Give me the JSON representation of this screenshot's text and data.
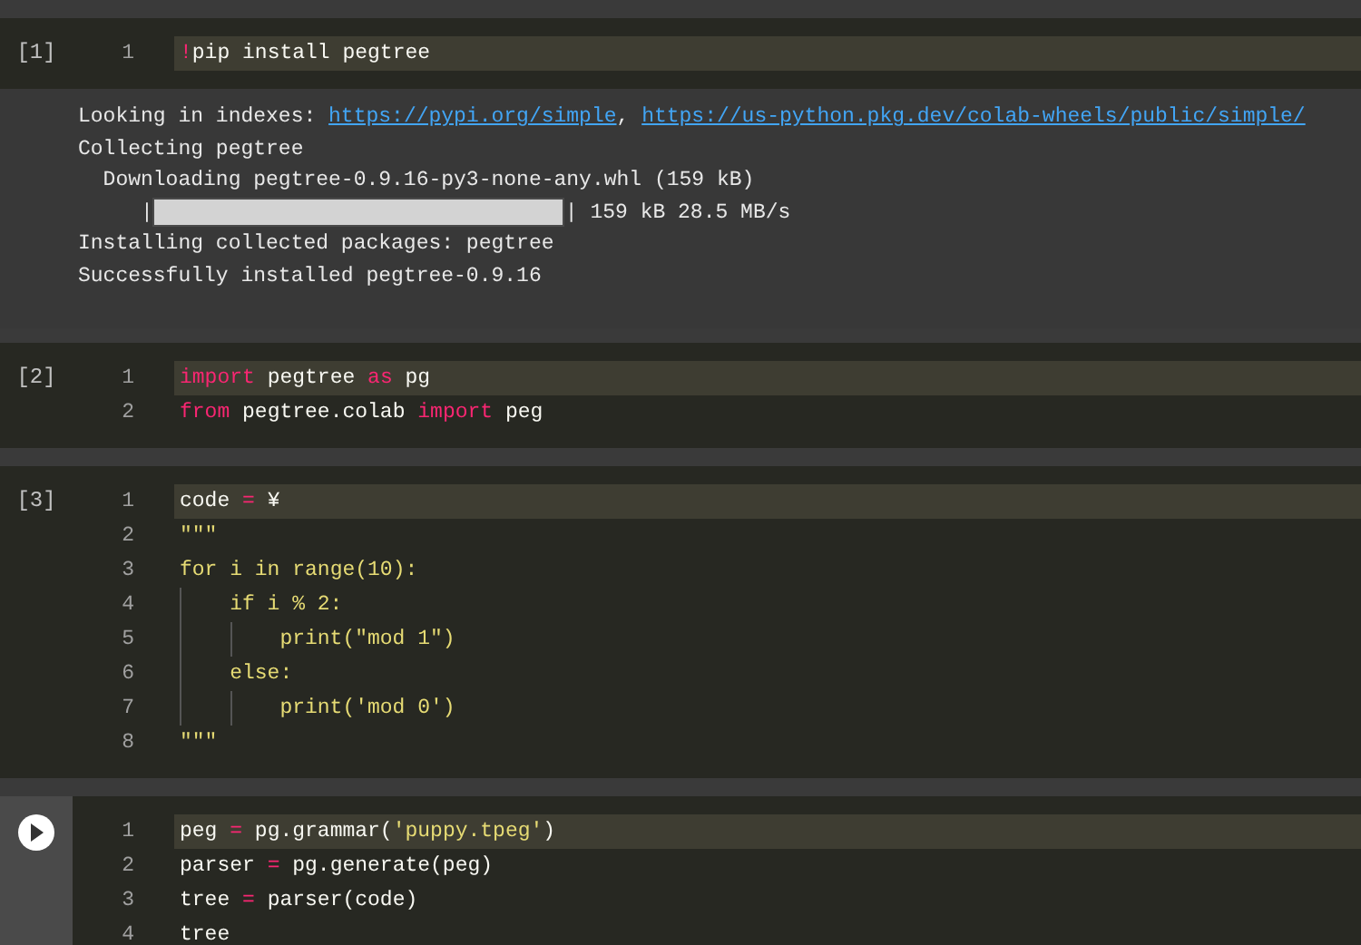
{
  "cells": [
    {
      "prompt": "[1]",
      "run_button": false,
      "lines": [
        {
          "number": "1",
          "current": true,
          "tokens": [
            {
              "kind": "kw",
              "text": "!"
            },
            {
              "kind": "plain",
              "text": "pip install pegtree"
            }
          ]
        }
      ],
      "output": [
        {
          "kind": "links",
          "parts": [
            {
              "kind": "text",
              "text": "Looking in indexes: "
            },
            {
              "kind": "link",
              "text": "https://pypi.org/simple"
            },
            {
              "kind": "text",
              "text": ", "
            },
            {
              "kind": "link",
              "text": "https://us-python.pkg.dev/colab-wheels/public/simple/"
            }
          ]
        },
        {
          "kind": "text",
          "text": "Collecting pegtree"
        },
        {
          "kind": "text",
          "text": "  Downloading pegtree-0.9.16-py3-none-any.whl (159 kB)"
        },
        {
          "kind": "progress",
          "prefix": "     |",
          "suffix": "| 159 kB 28.5 MB/s",
          "level": 1
        },
        {
          "kind": "text",
          "text": "Installing collected packages: pegtree"
        },
        {
          "kind": "text",
          "text": "Successfully installed pegtree-0.9.16"
        }
      ]
    },
    {
      "prompt": "[2]",
      "run_button": false,
      "lines": [
        {
          "number": "1",
          "current": true,
          "tokens": [
            {
              "kind": "kw",
              "text": "import"
            },
            {
              "kind": "plain",
              "text": " pegtree "
            },
            {
              "kind": "kw",
              "text": "as"
            },
            {
              "kind": "plain",
              "text": " pg"
            }
          ]
        },
        {
          "number": "2",
          "current": false,
          "tokens": [
            {
              "kind": "kw",
              "text": "from"
            },
            {
              "kind": "plain",
              "text": " pegtree.colab "
            },
            {
              "kind": "kw",
              "text": "import"
            },
            {
              "kind": "plain",
              "text": " peg"
            }
          ]
        }
      ]
    },
    {
      "prompt": "[3]",
      "run_button": false,
      "lines": [
        {
          "number": "1",
          "current": true,
          "tokens": [
            {
              "kind": "plain",
              "text": "code "
            },
            {
              "kind": "kw",
              "text": "="
            },
            {
              "kind": "plain",
              "text": " ¥"
            }
          ]
        },
        {
          "number": "2",
          "current": false,
          "tokens": [
            {
              "kind": "str",
              "text": "\"\"\""
            }
          ]
        },
        {
          "number": "3",
          "current": false,
          "tokens": [
            {
              "kind": "str",
              "text": "for i in range(10):"
            }
          ]
        },
        {
          "number": "4",
          "current": false,
          "tokens": [
            {
              "kind": "str",
              "text": "    if i % 2:"
            }
          ]
        },
        {
          "number": "5",
          "current": false,
          "tokens": [
            {
              "kind": "str",
              "text": "        print(\"mod 1\")"
            }
          ]
        },
        {
          "number": "6",
          "current": false,
          "tokens": [
            {
              "kind": "str",
              "text": "    else:"
            }
          ]
        },
        {
          "number": "7",
          "current": false,
          "tokens": [
            {
              "kind": "str",
              "text": "        print('mod 0')"
            }
          ]
        },
        {
          "number": "8",
          "current": false,
          "tokens": [
            {
              "kind": "str",
              "text": "\"\"\""
            }
          ]
        }
      ]
    },
    {
      "run_button": true,
      "lines": [
        {
          "number": "1",
          "current": true,
          "tokens": [
            {
              "kind": "plain",
              "text": "peg "
            },
            {
              "kind": "kw",
              "text": "="
            },
            {
              "kind": "plain",
              "text": " pg.grammar("
            },
            {
              "kind": "str",
              "text": "'puppy.tpeg'"
            },
            {
              "kind": "plain",
              "text": ")"
            }
          ]
        },
        {
          "number": "2",
          "current": false,
          "tokens": [
            {
              "kind": "plain",
              "text": "parser "
            },
            {
              "kind": "kw",
              "text": "="
            },
            {
              "kind": "plain",
              "text": " pg.generate(peg)"
            }
          ]
        },
        {
          "number": "3",
          "current": false,
          "tokens": [
            {
              "kind": "plain",
              "text": "tree "
            },
            {
              "kind": "kw",
              "text": "="
            },
            {
              "kind": "plain",
              "text": " parser(code)"
            }
          ]
        },
        {
          "number": "4",
          "current": false,
          "tokens": [
            {
              "kind": "plain",
              "text": "tree"
            }
          ]
        }
      ]
    }
  ]
}
